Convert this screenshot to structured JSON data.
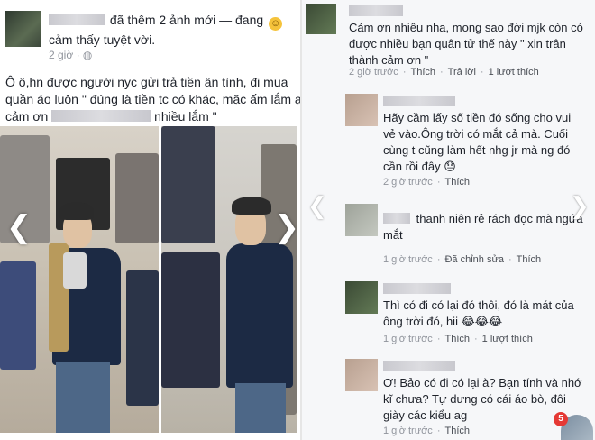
{
  "post": {
    "header_text": "đã thêm 2 ảnh mới — đang",
    "feeling_icon": "smile-icon",
    "feeling_glyph": "☺",
    "feeling_text": "cảm thấy tuyệt vời.",
    "timestamp": "2 giờ",
    "privacy_icon": "globe-icon",
    "privacy_glyph": "◍",
    "text_line1": "Ô ô,hn được người nyc gửi trả tiền ân tình, đi mua",
    "text_line2": "quần áo luôn \" đúng là tiền tc có khác, mặc ấm lắm ạ",
    "text_line3_start": "cảm ơn",
    "text_line3_end": "nhiều lắm \"",
    "prev_glyph": "❮",
    "next_glyph": "❯"
  },
  "comments": [
    {
      "text": "Cảm ơn nhiều nha, mong sao đời mjk còn có được nhiều bạn quân tử thế này \" xin trân thành cảm ơn \"",
      "time": "2 giờ trước",
      "actions": [
        "Thích",
        "Trả lời"
      ],
      "likes": "1 lượt thích"
    },
    {
      "text": "Hãy cầm lấy số tiền đó sống cho vui vẻ vào.Ông trời có mắt cả mà. Cuối cùng t cũng làm hết nhg jr mà ng đó cần rồi đây",
      "emoji": "😓",
      "time": "2 giờ trước",
      "actions": [
        "Thích"
      ],
      "likes": ""
    },
    {
      "text": "thanh niên rẻ rách đọc mà ngứa mắt",
      "time": "1 giờ trước",
      "actions": [
        "Đã chỉnh sửa",
        "Thích"
      ],
      "likes": ""
    },
    {
      "text": "Thì có đi có lại đó thôi, đó là mát của ông trời đó, hii",
      "emoji": "😂😂😂",
      "time": "1 giờ trước",
      "actions": [
        "Thích"
      ],
      "likes": "1 lượt thích"
    },
    {
      "text": "Ơ! Bảo có đi có lại à? Bạn tính và nhớ kĩ chưa? Tự dưng có cái áo bò, đôi giày các kiểu ag",
      "time": "1 giờ trước",
      "actions": [
        "Thích"
      ],
      "likes": ""
    }
  ],
  "notification_count": "5",
  "side_prev_glyph": "❮",
  "side_next_glyph": "❯",
  "colors": {
    "text": "#1d2129",
    "meta": "#90949c",
    "badge": "#e53935"
  }
}
